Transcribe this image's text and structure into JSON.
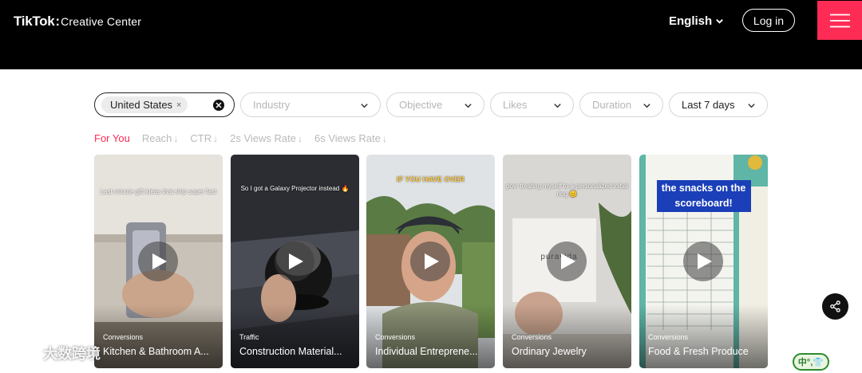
{
  "header": {
    "brand": "TikTok",
    "separator": ":",
    "product": "Creative Center",
    "language": "English",
    "login_label": "Log in"
  },
  "filters": {
    "country": "United States",
    "industry_placeholder": "Industry",
    "objective_placeholder": "Objective",
    "likes_placeholder": "Likes",
    "duration_placeholder": "Duration",
    "period": "Last 7 days"
  },
  "sort_tabs": [
    {
      "label": "For You",
      "arrow": ""
    },
    {
      "label": "Reach",
      "arrow": "↓"
    },
    {
      "label": "CTR",
      "arrow": "↓"
    },
    {
      "label": "2s Views Rate",
      "arrow": "↓"
    },
    {
      "label": "6s Views Rate",
      "arrow": "↓"
    }
  ],
  "cards": [
    {
      "tag": "Conversions",
      "title": "Kitchen & Bathroom A...",
      "caption": "Last minute gift ideas that ship super fast"
    },
    {
      "tag": "Traffic",
      "title": "Construction Material...",
      "caption": "So I got a Galaxy Projector instead 🔥"
    },
    {
      "tag": "Conversions",
      "title": "Individual Entreprene...",
      "caption": "IF YOU HAVE OVER"
    },
    {
      "tag": "Conversions",
      "title": "Ordinary Jewelry",
      "caption": "pov: treating myself to a personalized initial ring 😊",
      "box_text": "puravida"
    },
    {
      "tag": "Conversions",
      "title": "Food & Fresh Produce",
      "caption": "the snacks on the scoreboard!"
    }
  ],
  "watermark": "大数跨境",
  "corner_badge": "中°,👕",
  "colors": {
    "accent": "#fe2c55",
    "topbar": "#000000"
  }
}
